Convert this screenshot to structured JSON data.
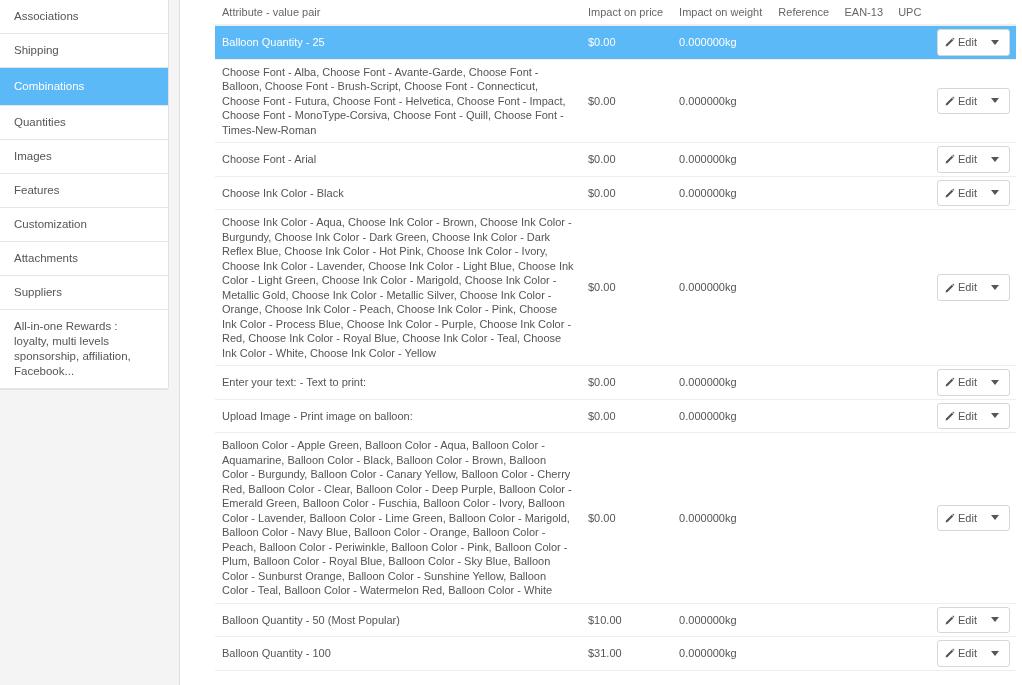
{
  "sidebar": {
    "items": [
      {
        "label": "Associations",
        "selected": false
      },
      {
        "label": "Shipping",
        "selected": false
      },
      {
        "label": "Combinations",
        "selected": true
      },
      {
        "label": "Quantities",
        "selected": false
      },
      {
        "label": "Images",
        "selected": false
      },
      {
        "label": "Features",
        "selected": false
      },
      {
        "label": "Customization",
        "selected": false
      },
      {
        "label": "Attachments",
        "selected": false
      },
      {
        "label": "Suppliers",
        "selected": false
      },
      {
        "label": "All-in-one Rewards : loyalty, multi levels sponsorship, affiliation, Facebook...",
        "selected": false
      }
    ]
  },
  "table": {
    "columns": [
      "Attribute - value pair",
      "Impact on price",
      "Impact on weight",
      "Reference",
      "EAN-13",
      "UPC"
    ],
    "rows": [
      {
        "attribute": "Balloon Quantity - 25",
        "price": "$0.00",
        "weight": "0.000000kg",
        "action": "Edit",
        "selected": true
      },
      {
        "attribute": "Choose Font - Alba, Choose Font - Avante-Garde, Choose Font - Balloon, Choose Font - Brush-Script, Choose Font - Connecticut, Choose Font - Futura, Choose Font - Helvetica, Choose Font - Impact, Choose Font - MonoType-Corsiva, Choose Font - Quill, Choose Font - Times-New-Roman",
        "price": "$0.00",
        "weight": "0.000000kg",
        "action": "Edit",
        "selected": false
      },
      {
        "attribute": "Choose Font - Arial",
        "price": "$0.00",
        "weight": "0.000000kg",
        "action": "Edit",
        "selected": false
      },
      {
        "attribute": "Choose Ink Color - Black",
        "price": "$0.00",
        "weight": "0.000000kg",
        "action": "Edit",
        "selected": false
      },
      {
        "attribute": "Choose Ink Color - Aqua, Choose Ink Color - Brown, Choose Ink Color - Burgundy, Choose Ink Color - Dark Green, Choose Ink Color - Dark Reflex Blue, Choose Ink Color - Hot Pink, Choose Ink Color - Ivory, Choose Ink Color - Lavender, Choose Ink Color - Light Blue, Choose Ink Color - Light Green, Choose Ink Color - Marigold, Choose Ink Color - Metallic Gold, Choose Ink Color - Metallic Silver, Choose Ink Color - Orange, Choose Ink Color - Peach, Choose Ink Color - Pink, Choose Ink Color - Process Blue, Choose Ink Color - Purple, Choose Ink Color - Red, Choose Ink Color - Royal Blue, Choose Ink Color - Teal, Choose Ink Color - White, Choose Ink Color - Yellow",
        "price": "$0.00",
        "weight": "0.000000kg",
        "action": "Edit",
        "selected": false
      },
      {
        "attribute": "Enter your text: - Text to print:",
        "price": "$0.00",
        "weight": "0.000000kg",
        "action": "Edit",
        "selected": false
      },
      {
        "attribute": "Upload Image - Print image on balloon:",
        "price": "$0.00",
        "weight": "0.000000kg",
        "action": "Edit",
        "selected": false
      },
      {
        "attribute": "Balloon Color - Apple Green, Balloon Color - Aqua, Balloon Color - Aquamarine, Balloon Color - Black, Balloon Color - Brown, Balloon Color - Burgundy, Balloon Color - Canary Yellow, Balloon Color - Cherry Red, Balloon Color - Clear, Balloon Color - Deep Purple, Balloon Color - Emerald Green, Balloon Color - Fuschia, Balloon Color - Ivory, Balloon Color - Lavender, Balloon Color - Lime Green, Balloon Color - Marigold, Balloon Color - Navy Blue, Balloon Color - Orange, Balloon Color - Peach, Balloon Color - Periwinkle, Balloon Color - Pink, Balloon Color - Plum, Balloon Color - Royal Blue, Balloon Color - Sky Blue, Balloon Color - Sunburst Orange, Balloon Color - Sunshine Yellow, Balloon Color - Teal, Balloon Color - Watermelon Red, Balloon Color - White",
        "price": "$0.00",
        "weight": "0.000000kg",
        "action": "Edit",
        "selected": false
      },
      {
        "attribute": "Balloon Quantity - 50 (Most Popular)",
        "price": "$10.00",
        "weight": "0.000000kg",
        "action": "Edit",
        "selected": false
      },
      {
        "attribute": "Balloon Quantity - 100",
        "price": "$31.00",
        "weight": "0.000000kg",
        "action": "Edit",
        "selected": false
      }
    ]
  }
}
